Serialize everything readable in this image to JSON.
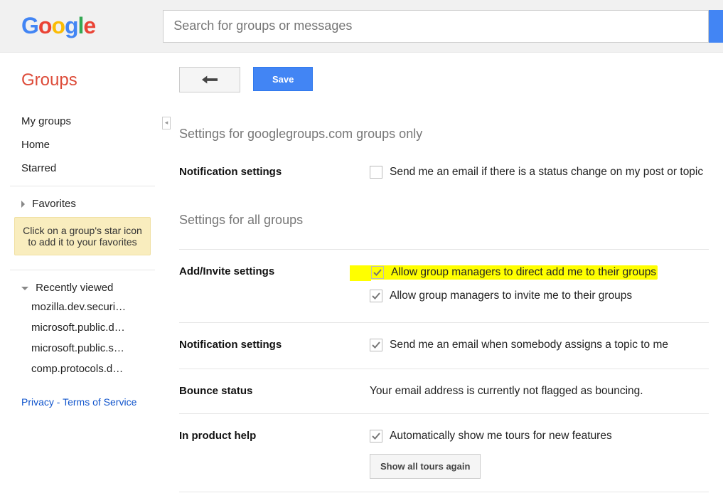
{
  "search": {
    "placeholder": "Search for groups or messages"
  },
  "app_title": "Groups",
  "nav": {
    "my_groups": "My groups",
    "home": "Home",
    "starred": "Starred"
  },
  "favorites": {
    "heading": "Favorites",
    "hint": "Click on a group's star icon to add it to your favorites"
  },
  "recent": {
    "heading": "Recently viewed",
    "items": [
      "mozilla.dev.securi…",
      "microsoft.public.d…",
      "microsoft.public.s…",
      "comp.protocols.d…"
    ]
  },
  "footer": {
    "privacy": "Privacy",
    "tos": "Terms of Service"
  },
  "toolbar": {
    "save_label": "Save"
  },
  "headings": {
    "gg_only": "Settings for googlegroups.com groups only",
    "all_groups": "Settings for all groups"
  },
  "settings": {
    "notif1": {
      "label": "Notification settings",
      "opt1": "Send me an email if there is a status change on my post or topic"
    },
    "add_invite": {
      "label": "Add/Invite settings",
      "opt1": "Allow group managers to direct add me to their groups",
      "opt2": "Allow group managers to invite me to their groups"
    },
    "notif2": {
      "label": "Notification settings",
      "opt1": "Send me an email when somebody assigns a topic to me"
    },
    "bounce": {
      "label": "Bounce status",
      "text": "Your email address is currently not flagged as bouncing."
    },
    "help": {
      "label": "In product help",
      "opt1": "Automatically show me tours for new features",
      "button": "Show all tours again"
    }
  },
  "checkbox_states": {
    "notif1_opt1": false,
    "add_invite_opt1": true,
    "add_invite_opt2": true,
    "notif2_opt1": true,
    "help_opt1": true
  }
}
